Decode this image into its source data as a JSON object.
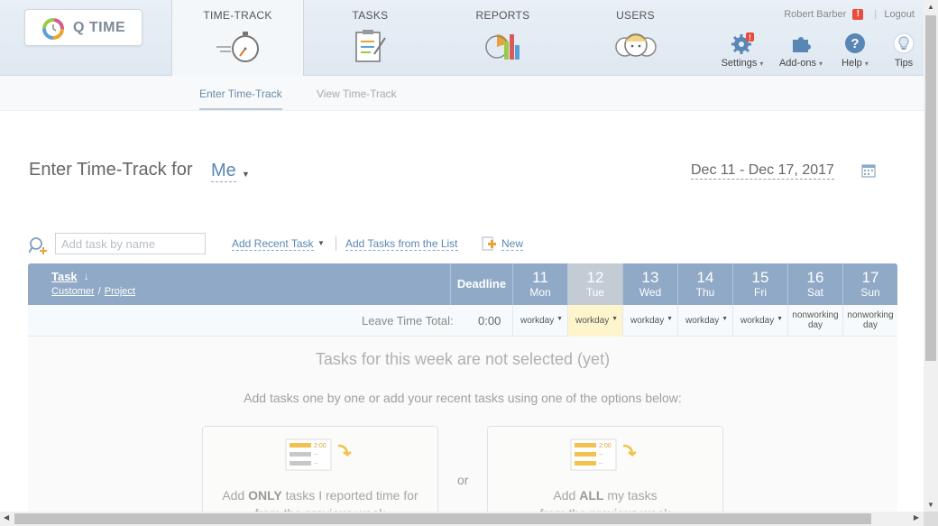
{
  "app": {
    "logo_text": "Q TIME"
  },
  "nav": {
    "tabs": [
      {
        "label": "TIME-TRACK",
        "icon": "stopwatch-icon",
        "active": true
      },
      {
        "label": "TASKS",
        "icon": "clipboard-icon",
        "active": false
      },
      {
        "label": "REPORTS",
        "icon": "chart-icon",
        "active": false
      },
      {
        "label": "USERS",
        "icon": "users-icon",
        "active": false
      }
    ]
  },
  "user": {
    "name": "Robert Barber",
    "alert": "!",
    "logout": "Logout"
  },
  "tools": [
    {
      "label": "Settings",
      "icon": "gear-icon"
    },
    {
      "label": "Add-ons",
      "icon": "puzzle-icon"
    },
    {
      "label": "Help",
      "icon": "help-icon"
    },
    {
      "label": "Tips",
      "icon": "lightbulb-icon"
    }
  ],
  "subnav": {
    "enter": "Enter Time-Track",
    "view": "View Time-Track"
  },
  "page": {
    "title": "Enter Time-Track for",
    "user_select": "Me",
    "date_range": "Dec 11 - Dec 17, 2017"
  },
  "add_bar": {
    "placeholder": "Add task by name",
    "recent": "Add Recent Task",
    "from_list": "Add Tasks from the List",
    "new": "New"
  },
  "grid": {
    "task_header": "Task",
    "customer": "Customer",
    "project": "Project",
    "deadline": "Deadline",
    "leave_label": "Leave Time Total:",
    "leave_value": "0:00",
    "days": [
      {
        "num": "11",
        "name": "Mon",
        "type": "workday",
        "today": false
      },
      {
        "num": "12",
        "name": "Tue",
        "type": "workday",
        "today": true
      },
      {
        "num": "13",
        "name": "Wed",
        "type": "workday",
        "today": false
      },
      {
        "num": "14",
        "name": "Thu",
        "type": "workday",
        "today": false
      },
      {
        "num": "15",
        "name": "Fri",
        "type": "workday",
        "today": false
      },
      {
        "num": "16",
        "name": "Sat",
        "type": "nonworking day",
        "today": false
      },
      {
        "num": "17",
        "name": "Sun",
        "type": "nonworking day",
        "today": false
      }
    ]
  },
  "empty_state": {
    "title": "Tasks for this week are not selected (yet)",
    "desc": "Add tasks one by one or add your recent tasks using one of the options below:",
    "option1_pre": "Add ",
    "option1_bold": "ONLY",
    "option1_post": " tasks I reported time for",
    "option1_line2": "from the previous week",
    "or": "or",
    "option2_pre": "Add ",
    "option2_bold": "ALL",
    "option2_post": " my tasks",
    "option2_line2": "from the previous week",
    "ill_time": "2:00",
    "ill_dash": "--"
  },
  "colors": {
    "grid_header": "#8fa9c6",
    "link": "#5b87b5",
    "today": "#c3ccd5",
    "highlight": "#fff5cc",
    "alert": "#e84c3d"
  }
}
